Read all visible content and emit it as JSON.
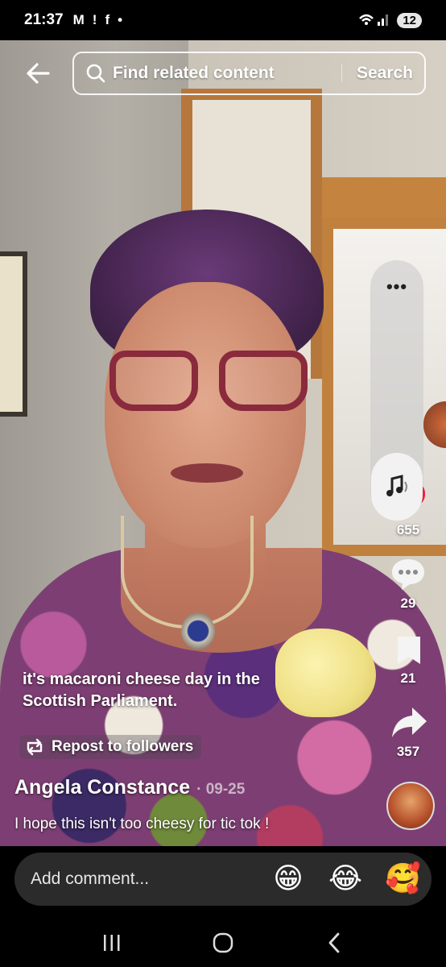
{
  "status_bar": {
    "time": "21:37",
    "notification_icons": [
      "gmail-icon",
      "alert-icon",
      "facebook-icon"
    ],
    "battery": "12"
  },
  "search": {
    "placeholder": "Find related content",
    "button_label": "Search"
  },
  "rail": {
    "more_label": "•••",
    "like_count": "655",
    "comment_count": "29",
    "save_count": "21",
    "share_count": "357"
  },
  "video": {
    "caption": "it's macaroni cheese day in the Scottish Parliament.",
    "repost_label": "Repost to followers"
  },
  "top_comment": {
    "author": "Angela Constance",
    "date": "· 09-25",
    "text": "I hope this isn't too cheesy for tic tok !"
  },
  "comment_bar": {
    "placeholder": "Add comment...",
    "emojis": [
      "😁",
      "😂",
      "🥰"
    ]
  },
  "colors": {
    "accent_red": "#e8233e",
    "comment_bar_bg": "#2b2b2b"
  }
}
